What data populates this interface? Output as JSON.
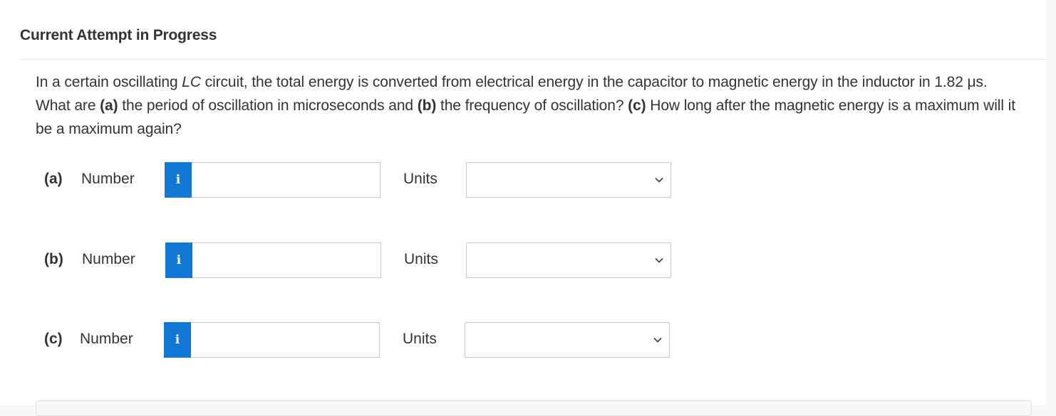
{
  "header": {
    "title": "Current Attempt in Progress"
  },
  "question": {
    "text_1": "In a certain oscillating ",
    "lc": "LC",
    "text_2": " circuit, the total energy is converted from electrical energy in the capacitor to magnetic energy in the inductor in 1.82 μs. What are ",
    "a": "(a)",
    "text_3": " the period of oscillation in microseconds and ",
    "b": "(b)",
    "text_4": " the frequency of oscillation? ",
    "c": "(c)",
    "text_5": " How long after the magnetic energy is a maximum will it be a maximum again?"
  },
  "parts": [
    {
      "label": "(a)",
      "number_label": "Number",
      "info_icon": "i",
      "value": "",
      "units_label": "Units",
      "units_value": ""
    },
    {
      "label": "(b)",
      "number_label": "Number",
      "info_icon": "i",
      "value": "",
      "units_label": "Units",
      "units_value": ""
    },
    {
      "label": "(c)",
      "number_label": "Number",
      "info_icon": "i",
      "value": "",
      "units_label": "Units",
      "units_value": ""
    }
  ],
  "colors": {
    "info_button": "#1178d6",
    "text": "#333333"
  }
}
